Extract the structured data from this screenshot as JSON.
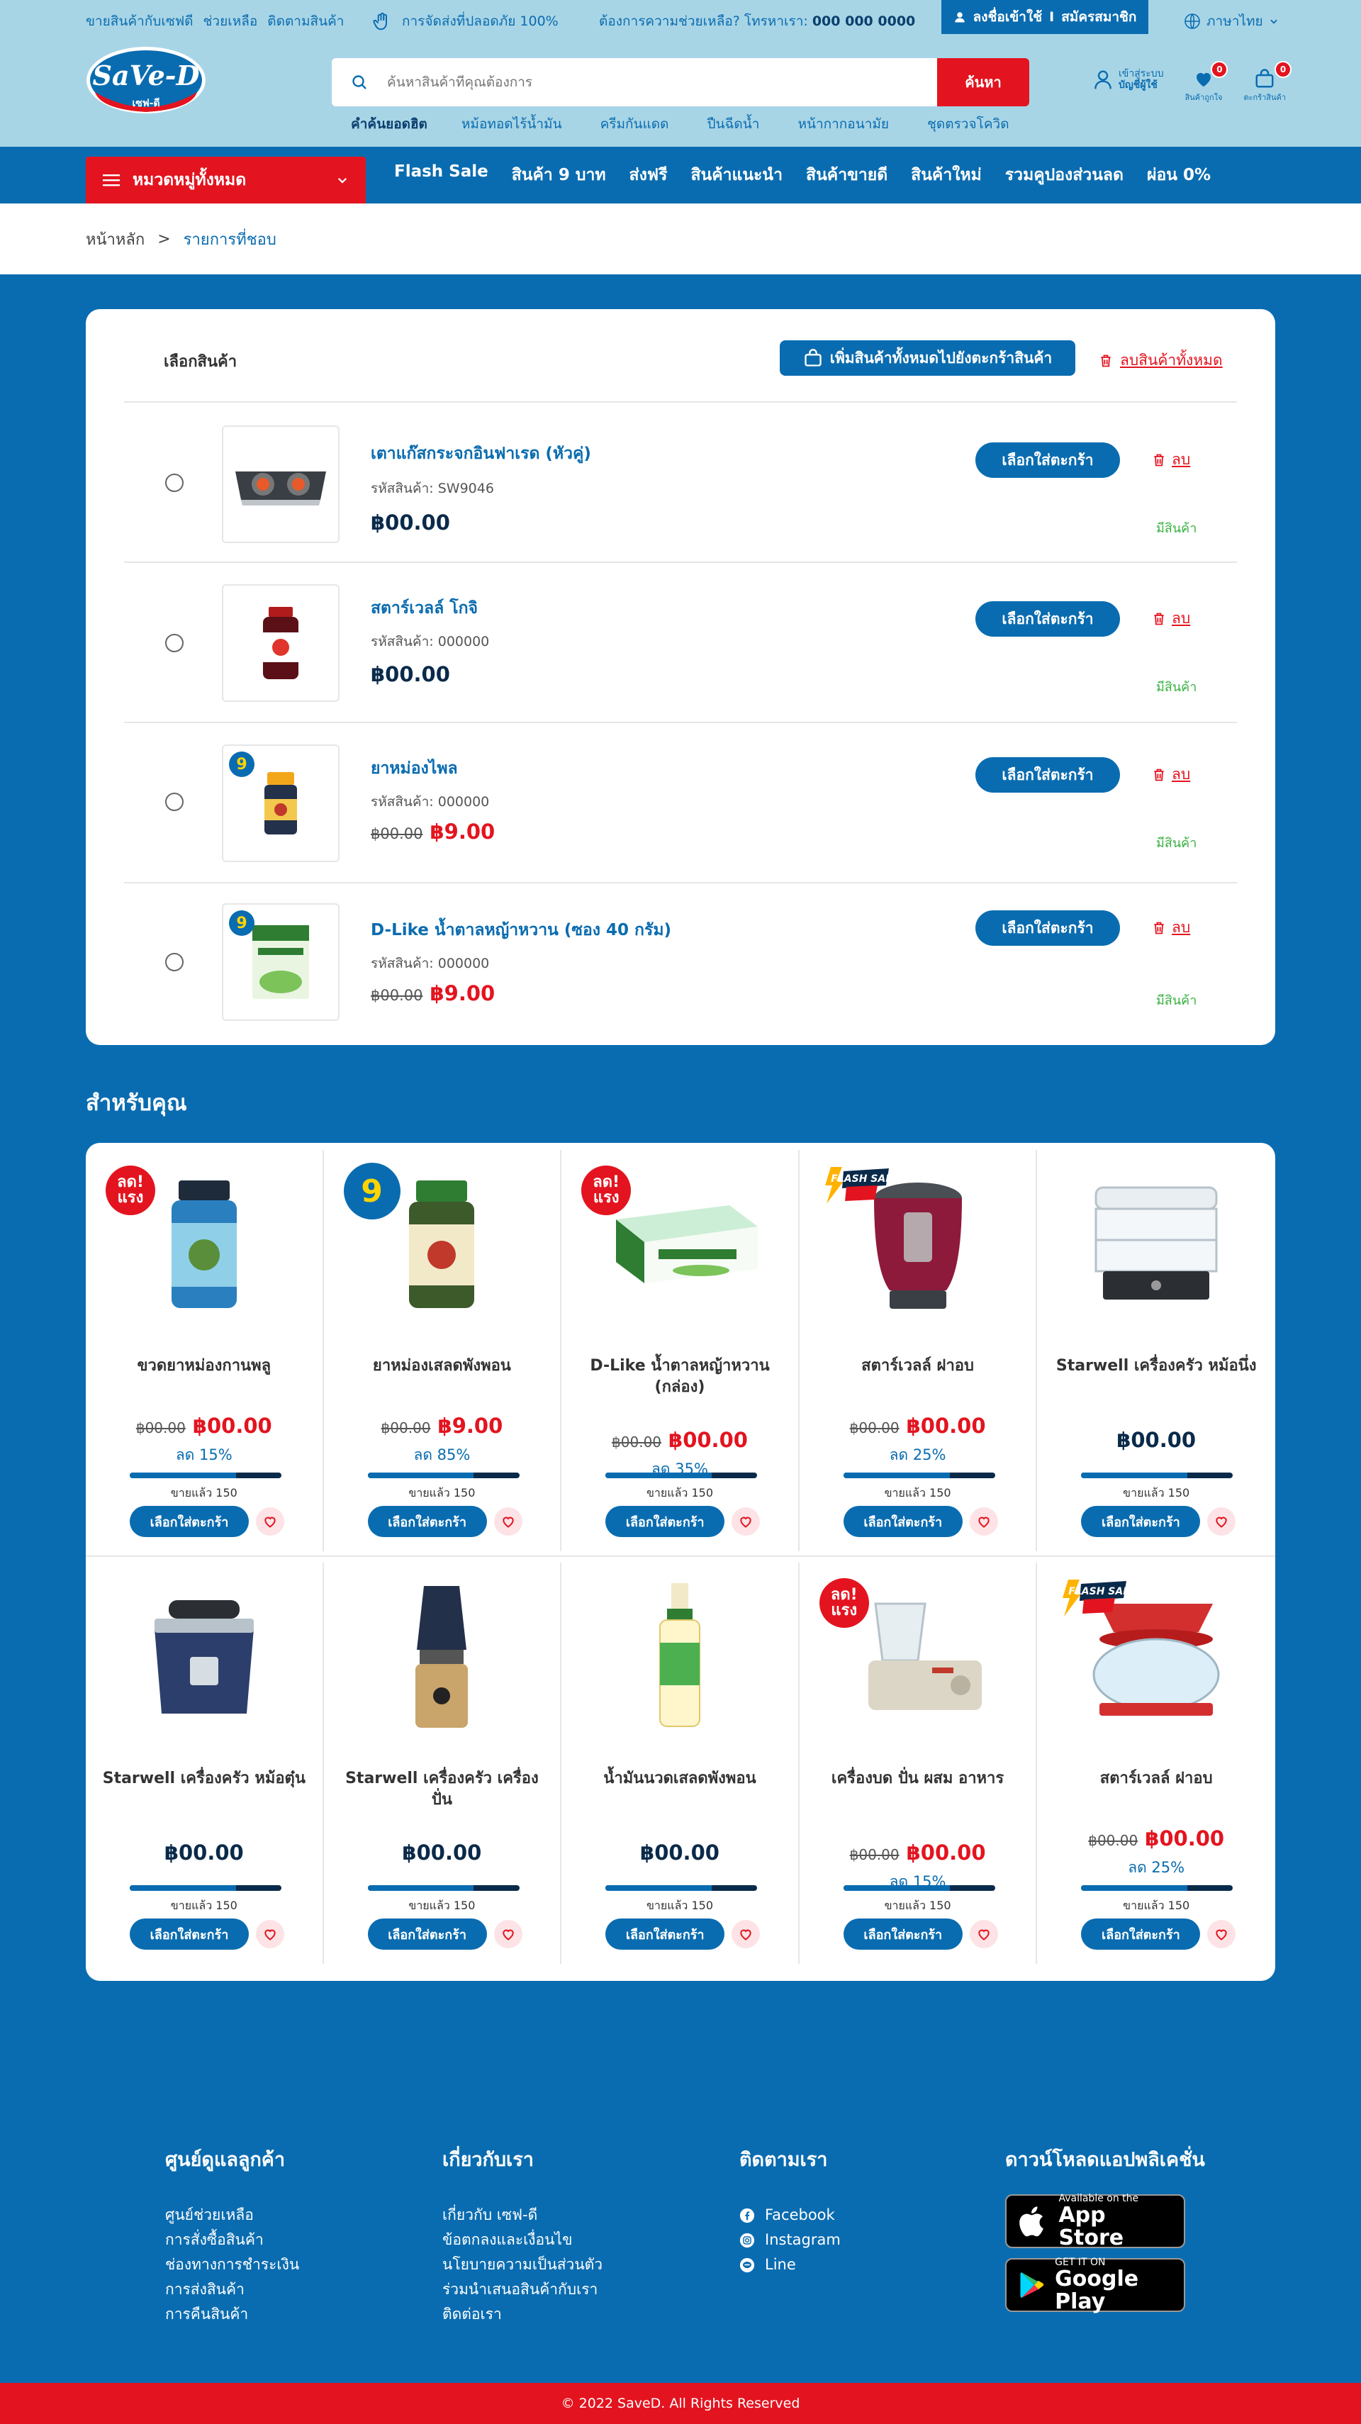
{
  "topbar": {
    "links": [
      "ขายสินค้ากับเซฟดี",
      "ช่วยเหลือ",
      "ติดตามสินค้า"
    ],
    "safe_delivery": "การจัดส่งที่ปลอดภัย 100%",
    "help_text": "ต้องการความช่วยเหลือ? โทรหาเรา:",
    "help_phone": "000 000 0000",
    "login": "ลงชื่อเข้าใช้",
    "separator": "I",
    "register": "สมัครสมาชิก",
    "language": "ภาษาไทย"
  },
  "logo": {
    "brand": "SaVe-D",
    "thai": "เซฟ-ดี"
  },
  "search": {
    "placeholder": "ค้นหาสินค้าที่คุณต้องการ",
    "button": "ค้นหา"
  },
  "popular": {
    "title": "คำค้นยอดฮิต",
    "items": [
      "หม้อทอดไร้น้ำมัน",
      "ครีมกันแดด",
      "ปืนฉีดน้ำ",
      "หน้ากากอนามัย",
      "ชุดตรวจโควิด"
    ]
  },
  "header_icons": {
    "account_line1": "เข้าสู่ระบบ",
    "account_line2": "บัญชีผู้ใช้",
    "wishlist_label": "สินค้าถูกใจ",
    "wishlist_count": "0",
    "cart_label": "ตะกร้าสินค้า",
    "cart_count": "0"
  },
  "nav": {
    "category_button": "หมวดหมู่ทั้งหมด",
    "links": [
      "Flash Sale",
      "สินค้า 9 บาท",
      "ส่งฟรี",
      "สินค้าแนะนำ",
      "สินค้าขายดี",
      "สินค้าใหม่",
      "รวมคูปองส่วนลด",
      "ผ่อน 0%"
    ]
  },
  "breadcrumb": {
    "home": "หน้าหลัก",
    "sep": ">",
    "current": "รายการที่ชอบ"
  },
  "wishlist": {
    "select_label": "เลือกสินค้า",
    "add_all": "เพิ่มสินค้าทั้งหมดไปยังตะกร้าสินค้า",
    "delete_all": "ลบสินค้าทั้งหมด",
    "cart_btn": "เลือกใส่ตะกร้า",
    "delete_btn": "ลบ",
    "stock": "มีสินค้า",
    "items": [
      {
        "name": "เตาแก๊สกระจกอินฟาเรด (หัวคู่)",
        "sku": "รหัสสินค้า: SW9046",
        "price": "฿00.00",
        "old_price": "",
        "sale_price": ""
      },
      {
        "name": "สตาร์เวลล์ โกจิ",
        "sku": "รหัสสินค้า: 000000",
        "price": "฿00.00",
        "old_price": "",
        "sale_price": ""
      },
      {
        "name": "ยาหม่องไพล",
        "sku": "รหัสสินค้า: 000000",
        "price": "",
        "old_price": "฿00.00",
        "sale_price": "฿9.00",
        "badge": "9"
      },
      {
        "name": "D-Like น้ำตาลหญ้าหวาน (ซอง 40 กรัม)",
        "sku": "รหัสสินค้า: 000000",
        "price": "",
        "old_price": "฿00.00",
        "sale_price": "฿9.00",
        "badge": "9"
      }
    ]
  },
  "foryou": {
    "title": "สำหรับคุณ",
    "cart_btn": "เลือกใส่ตะกร้า",
    "products": [
      {
        "name": "ขวดยาหม่องกานพลู",
        "old": "฿00.00",
        "price": "฿00.00",
        "sale": true,
        "disc": "ลด 15%",
        "sold": "ขายแล้ว 150",
        "tag": "hot",
        "tag_text": "ลด! แรง",
        "sold_pct": 70
      },
      {
        "name": "ยาหม่องเสลดพังพอน",
        "old": "฿00.00",
        "price": "฿9.00",
        "sale": true,
        "disc": "ลด 85%",
        "sold": "ขายแล้ว 150",
        "tag": "nine",
        "tag_text": "9",
        "sold_pct": 70
      },
      {
        "name": "D-Like น้ำตาลหญ้าหวาน (กล่อง)",
        "old": "฿00.00",
        "price": "฿00.00",
        "sale": true,
        "disc": "ลด 35%",
        "sold": "ขายแล้ว 150",
        "tag": "hot",
        "tag_text": "ลด! แรง",
        "sold_pct": 70
      },
      {
        "name": "สตาร์เวลล์ ฝาอบ",
        "old": "฿00.00",
        "price": "฿00.00",
        "sale": true,
        "disc": "ลด 25%",
        "sold": "ขายแล้ว 150",
        "tag": "flash",
        "tag_text": "FLASH SALE",
        "sold_pct": 70
      },
      {
        "name": "Starwell เครื่องครัว หม้อนึ่ง",
        "old": "",
        "price": "฿00.00",
        "sale": false,
        "disc": "",
        "sold": "ขายแล้ว 150",
        "tag": "",
        "tag_text": "",
        "sold_pct": 70
      },
      {
        "name": "Starwell เครื่องครัว หม้อตุ๋น",
        "old": "",
        "price": "฿00.00",
        "sale": false,
        "disc": "",
        "sold": "ขายแล้ว 150",
        "tag": "",
        "tag_text": "",
        "sold_pct": 70
      },
      {
        "name": "Starwell เครื่องครัว เครื่องปั่น",
        "old": "",
        "price": "฿00.00",
        "sale": false,
        "disc": "",
        "sold": "ขายแล้ว 150",
        "tag": "",
        "tag_text": "",
        "sold_pct": 70
      },
      {
        "name": "น้ำมันนวดเสลดพังพอน",
        "old": "",
        "price": "฿00.00",
        "sale": false,
        "disc": "",
        "sold": "ขายแล้ว 150",
        "tag": "",
        "tag_text": "",
        "sold_pct": 70
      },
      {
        "name": "เครื่องบด ปั่น ผสม อาหาร",
        "old": "฿00.00",
        "price": "฿00.00",
        "sale": true,
        "disc": "ลด 15%",
        "sold": "ขายแล้ว 150",
        "tag": "hot",
        "tag_text": "ลด! แรง",
        "sold_pct": 70
      },
      {
        "name": "สตาร์เวลล์ ฝาอบ",
        "old": "฿00.00",
        "price": "฿00.00",
        "sale": true,
        "disc": "ลด 25%",
        "sold": "ขายแล้ว 150",
        "tag": "flash",
        "tag_text": "FLASH SALE",
        "sold_pct": 70
      }
    ]
  },
  "footer": {
    "col1": {
      "title": "ศูนย์ดูแลลูกค้า",
      "links": [
        "ศูนย์ช่วยเหลือ",
        "การสั่งซื้อสินค้า",
        "ช่องทางการชำระเงิน",
        "การส่งสินค้า",
        "การคืนสินค้า"
      ]
    },
    "col2": {
      "title": "เกี่ยวกับเรา",
      "links": [
        "เกี่ยวกับ เซฟ-ดี",
        "ข้อตกลงและเงื่อนไข",
        "นโยบายความเป็นส่วนตัว",
        "ร่วมนำเสนอสินค้ากับเรา",
        "ติดต่อเรา"
      ]
    },
    "col3": {
      "title": "ติดตามเรา",
      "links": [
        "Facebook",
        "Instagram",
        "Line"
      ]
    },
    "col4": {
      "title": "ดาวน์โหลดแอปพลิเคชั่น",
      "appstore_small": "Available on the",
      "appstore_big": "App Store",
      "play_small": "GET IT ON",
      "play_big": "Google Play"
    },
    "copyright": "© 2022 SaveD. All Rights Reserved"
  },
  "colors": {
    "primary": "#0a6cb0",
    "accent": "#e3141f",
    "header_bg": "#a8d5e6",
    "stock": "#3bb043"
  }
}
